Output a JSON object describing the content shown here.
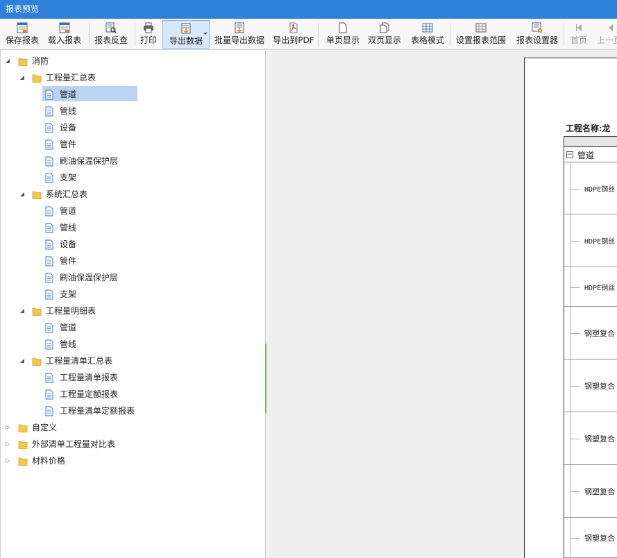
{
  "window": {
    "title": "报表预览"
  },
  "toolbar": {
    "buttons": [
      {
        "label": "保存报表",
        "icon": "save-report-icon"
      },
      {
        "label": "载入报表",
        "icon": "load-report-icon"
      },
      {
        "label": "报表反查",
        "icon": "report-lookup-icon"
      },
      {
        "label": "打印",
        "icon": "printer-icon"
      },
      {
        "label": "导出数据",
        "icon": "export-data-icon"
      },
      {
        "label": "批量导出数据",
        "icon": "batch-export-icon"
      },
      {
        "label": "导出到PDF",
        "icon": "pdf-icon"
      },
      {
        "label": "单页显示",
        "icon": "single-page-icon"
      },
      {
        "label": "双页显示",
        "icon": "double-page-icon"
      },
      {
        "label": "表格模式",
        "icon": "table-mode-icon"
      },
      {
        "label": "设置报表范围",
        "icon": "report-range-icon"
      },
      {
        "label": "报表设置器",
        "icon": "report-settings-icon"
      },
      {
        "label": "首页",
        "icon": "first-page-icon"
      },
      {
        "label": "上一页",
        "icon": "prev-page-icon"
      }
    ]
  },
  "tree": {
    "items": [
      {
        "label": "消防",
        "type": "folder",
        "expanded": true,
        "level": 0
      },
      {
        "label": "工程量汇总表",
        "type": "folder",
        "expanded": true,
        "level": 1
      },
      {
        "label": "管道",
        "type": "doc",
        "level": 2,
        "selected": true
      },
      {
        "label": "管线",
        "type": "doc",
        "level": 2
      },
      {
        "label": "设备",
        "type": "doc",
        "level": 2
      },
      {
        "label": "管件",
        "type": "doc",
        "level": 2
      },
      {
        "label": "刷油保温保护层",
        "type": "doc",
        "level": 2
      },
      {
        "label": "支架",
        "type": "doc",
        "level": 2
      },
      {
        "label": "系统汇总表",
        "type": "folder",
        "expanded": true,
        "level": 1
      },
      {
        "label": "管道",
        "type": "doc",
        "level": 2
      },
      {
        "label": "管线",
        "type": "doc",
        "level": 2
      },
      {
        "label": "设备",
        "type": "doc",
        "level": 2
      },
      {
        "label": "管件",
        "type": "doc",
        "level": 2
      },
      {
        "label": "刷油保温保护层",
        "type": "doc",
        "level": 2
      },
      {
        "label": "支架",
        "type": "doc",
        "level": 2
      },
      {
        "label": "工程量明细表",
        "type": "folder",
        "expanded": true,
        "level": 1
      },
      {
        "label": "管道",
        "type": "doc",
        "level": 2
      },
      {
        "label": "管线",
        "type": "doc",
        "level": 2
      },
      {
        "label": "工程量清单汇总表",
        "type": "folder",
        "expanded": true,
        "level": 1
      },
      {
        "label": "工程量清单报表",
        "type": "doc",
        "level": 2
      },
      {
        "label": "工程量定额报表",
        "type": "doc",
        "level": 2
      },
      {
        "label": "工程量清单定额报表",
        "type": "doc",
        "level": 2
      },
      {
        "label": "自定义",
        "type": "folder",
        "expanded": false,
        "level": 0
      },
      {
        "label": "外部清单工程量对比表",
        "type": "folder",
        "expanded": false,
        "level": 0
      },
      {
        "label": "材料价格",
        "type": "folder",
        "expanded": false,
        "level": 0
      }
    ]
  },
  "preview": {
    "project_label": "工程名称:龙",
    "group_label": "管道",
    "rows": [
      {
        "label": "HDPE钢丝"
      },
      {
        "label": "HDPE钢丝"
      },
      {
        "label": "HDPE钢丝"
      },
      {
        "label": "钢塑复合"
      },
      {
        "label": "钢塑复合"
      },
      {
        "label": "钢塑复合"
      },
      {
        "label": "钢塑复合"
      },
      {
        "label": "钢塑复合"
      }
    ]
  },
  "colors": {
    "titlebar": "#2f80d9",
    "selection": "#b9d3f0",
    "splitter": "#72c15a",
    "folder": "#f2c94c"
  }
}
